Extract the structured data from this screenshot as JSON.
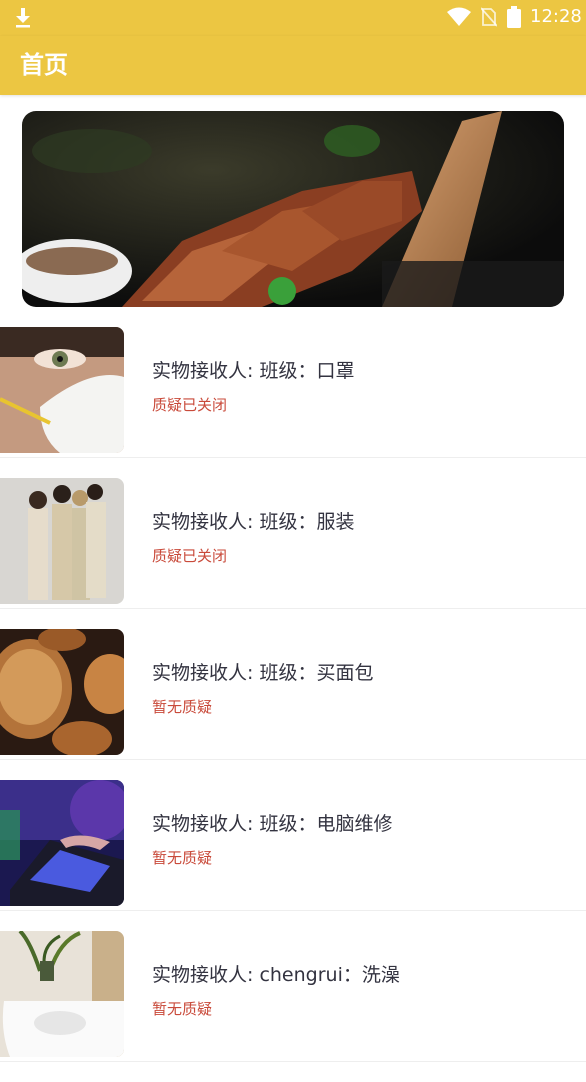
{
  "status_bar": {
    "time": "12:28"
  },
  "app_bar": {
    "title": "首页"
  },
  "colors": {
    "accent": "#ecc642",
    "status_text": "#c94a3a",
    "primary_text": "#333340"
  },
  "items": [
    {
      "name": "实物接收人: 班级：口罩",
      "status": "质疑已关闭"
    },
    {
      "name": "实物接收人: 班级：服装",
      "status": "质疑已关闭"
    },
    {
      "name": "实物接收人: 班级：买面包",
      "status": "暂无质疑"
    },
    {
      "name": "实物接收人: 班级：电脑维修",
      "status": "暂无质疑"
    },
    {
      "name": "实物接收人: chengrui：洗澡",
      "status": "暂无质疑"
    }
  ]
}
